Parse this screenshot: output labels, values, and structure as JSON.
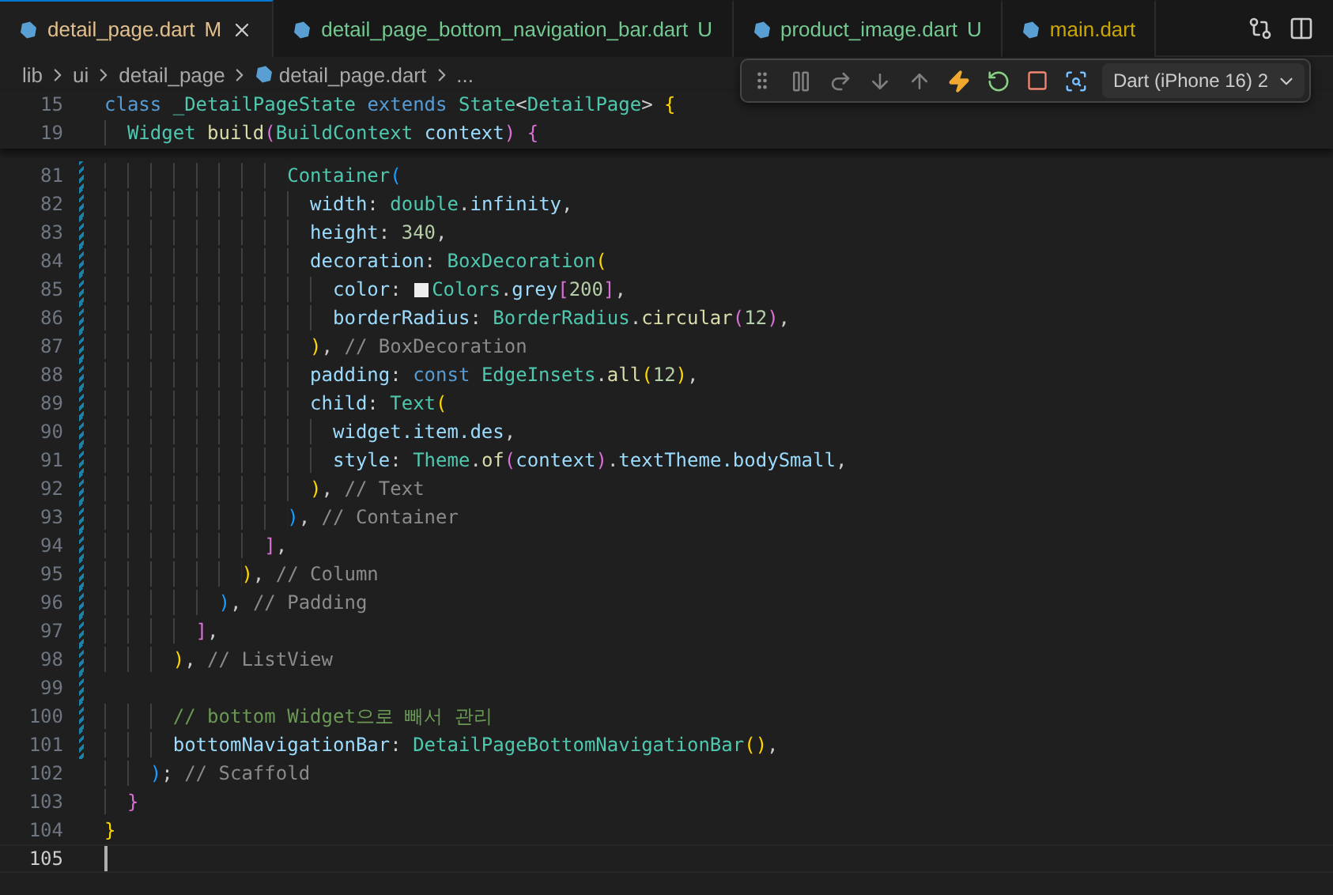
{
  "tabs": [
    {
      "label": "detail_page.dart",
      "badge": "M",
      "color": "#e2c08d",
      "selected": true
    },
    {
      "label": "detail_page_bottom_navigation_bar.dart",
      "badge": "U",
      "color": "#73c991",
      "selected": false
    },
    {
      "label": "product_image.dart",
      "badge": "U",
      "color": "#73c991",
      "selected": false
    },
    {
      "label": "main.dart",
      "color": "#cca700",
      "selected": false
    }
  ],
  "breadcrumb": [
    {
      "label": "lib",
      "kind": "folder"
    },
    {
      "label": "ui",
      "kind": "folder"
    },
    {
      "label": "detail_page",
      "kind": "folder"
    },
    {
      "label": "detail_page.dart",
      "kind": "file"
    },
    {
      "label": "...",
      "kind": "more"
    }
  ],
  "debug_toolbar": {
    "buttons": [
      {
        "kind": "grip",
        "disabled": false
      },
      {
        "kind": "pause",
        "disabled": true
      },
      {
        "kind": "step-over",
        "disabled": true
      },
      {
        "kind": "step-into",
        "disabled": true
      },
      {
        "kind": "step-out",
        "disabled": true
      },
      {
        "kind": "hot-reload",
        "disabled": false
      },
      {
        "kind": "restart",
        "disabled": false
      },
      {
        "kind": "stop",
        "disabled": false
      },
      {
        "kind": "inspect",
        "disabled": false
      }
    ],
    "device": "Dart (iPhone 16) 2"
  },
  "sticky_scroll": [
    {
      "number": "15",
      "tokens": [
        {
          "text": "class ",
          "kind": "kw"
        },
        {
          "text": "_DetailPageState ",
          "kind": "type"
        },
        {
          "text": "extends ",
          "kind": "kw"
        },
        {
          "text": "State",
          "kind": "type"
        },
        {
          "text": "<",
          "kind": "p"
        },
        {
          "text": "DetailPage",
          "kind": "type"
        },
        {
          "text": "> ",
          "kind": "p"
        },
        {
          "text": "{",
          "kind": "b1"
        }
      ]
    },
    {
      "number": "19",
      "tokens": [
        {
          "text": "  Widget ",
          "kind": "type"
        },
        {
          "text": "build",
          "kind": "fn"
        },
        {
          "text": "(",
          "kind": "b2"
        },
        {
          "text": "BuildContext ",
          "kind": "type"
        },
        {
          "text": "context",
          "kind": "prop"
        },
        {
          "text": ")",
          "kind": "b2"
        },
        {
          "text": " {",
          "kind": "b2"
        }
      ]
    }
  ],
  "lines": [
    {
      "number": "81",
      "modified": true,
      "current": false,
      "tokens": [
        {
          "text": "                Container",
          "kind": "type"
        },
        {
          "text": "(",
          "kind": "b3"
        }
      ]
    },
    {
      "number": "82",
      "modified": true,
      "current": false,
      "tokens": [
        {
          "text": "                  width",
          "kind": "prop"
        },
        {
          "text": ": ",
          "kind": "p"
        },
        {
          "text": "double",
          "kind": "type"
        },
        {
          "text": ".",
          "kind": "p"
        },
        {
          "text": "infinity",
          "kind": "prop"
        },
        {
          "text": ",",
          "kind": "p"
        }
      ]
    },
    {
      "number": "83",
      "modified": true,
      "current": false,
      "tokens": [
        {
          "text": "                  height",
          "kind": "prop"
        },
        {
          "text": ": ",
          "kind": "p"
        },
        {
          "text": "340",
          "kind": "num"
        },
        {
          "text": ",",
          "kind": "p"
        }
      ]
    },
    {
      "number": "84",
      "modified": true,
      "current": false,
      "tokens": [
        {
          "text": "                  decoration",
          "kind": "prop"
        },
        {
          "text": ": ",
          "kind": "p"
        },
        {
          "text": "BoxDecoration",
          "kind": "type"
        },
        {
          "text": "(",
          "kind": "b1"
        }
      ]
    },
    {
      "number": "85",
      "modified": true,
      "current": false,
      "tokens": [
        {
          "text": "                    color",
          "kind": "prop"
        },
        {
          "text": ": ",
          "kind": "p"
        },
        {
          "text": "Colors",
          "kind": "type",
          "color": "#eeeeee"
        },
        {
          "text": ".",
          "kind": "p"
        },
        {
          "text": "grey",
          "kind": "prop"
        },
        {
          "text": "[",
          "kind": "b2"
        },
        {
          "text": "200",
          "kind": "num"
        },
        {
          "text": "]",
          "kind": "b2"
        },
        {
          "text": ",",
          "kind": "p"
        }
      ]
    },
    {
      "number": "86",
      "modified": true,
      "current": false,
      "tokens": [
        {
          "text": "                    borderRadius",
          "kind": "prop"
        },
        {
          "text": ": ",
          "kind": "p"
        },
        {
          "text": "BorderRadius",
          "kind": "type"
        },
        {
          "text": ".",
          "kind": "p"
        },
        {
          "text": "circular",
          "kind": "fn"
        },
        {
          "text": "(",
          "kind": "b2"
        },
        {
          "text": "12",
          "kind": "num"
        },
        {
          "text": ")",
          "kind": "b2"
        },
        {
          "text": ",",
          "kind": "p"
        }
      ]
    },
    {
      "number": "87",
      "modified": true,
      "current": false,
      "tokens": [
        {
          "text": "                  )",
          "kind": "b1"
        },
        {
          "text": ", ",
          "kind": "p"
        },
        {
          "text": "// BoxDecoration",
          "kind": "label"
        }
      ]
    },
    {
      "number": "88",
      "modified": true,
      "current": false,
      "tokens": [
        {
          "text": "                  padding",
          "kind": "prop"
        },
        {
          "text": ": ",
          "kind": "p"
        },
        {
          "text": "const ",
          "kind": "kw"
        },
        {
          "text": "EdgeInsets",
          "kind": "type"
        },
        {
          "text": ".",
          "kind": "p"
        },
        {
          "text": "all",
          "kind": "fn"
        },
        {
          "text": "(",
          "kind": "b1"
        },
        {
          "text": "12",
          "kind": "num"
        },
        {
          "text": ")",
          "kind": "b1"
        },
        {
          "text": ",",
          "kind": "p"
        }
      ]
    },
    {
      "number": "89",
      "modified": true,
      "current": false,
      "tokens": [
        {
          "text": "                  child",
          "kind": "prop"
        },
        {
          "text": ": ",
          "kind": "p"
        },
        {
          "text": "Text",
          "kind": "type"
        },
        {
          "text": "(",
          "kind": "b1"
        }
      ]
    },
    {
      "number": "90",
      "modified": true,
      "current": false,
      "tokens": [
        {
          "text": "                    widget.item.des",
          "kind": "prop"
        },
        {
          "text": ",",
          "kind": "p"
        }
      ]
    },
    {
      "number": "91",
      "modified": true,
      "current": false,
      "tokens": [
        {
          "text": "                    style",
          "kind": "prop"
        },
        {
          "text": ": ",
          "kind": "p"
        },
        {
          "text": "Theme",
          "kind": "type"
        },
        {
          "text": ".",
          "kind": "p"
        },
        {
          "text": "of",
          "kind": "fn"
        },
        {
          "text": "(",
          "kind": "b2"
        },
        {
          "text": "context",
          "kind": "prop"
        },
        {
          "text": ")",
          "kind": "b2"
        },
        {
          "text": ".",
          "kind": "p"
        },
        {
          "text": "textTheme.bodySmall",
          "kind": "prop"
        },
        {
          "text": ",",
          "kind": "p"
        }
      ]
    },
    {
      "number": "92",
      "modified": true,
      "current": false,
      "tokens": [
        {
          "text": "                  )",
          "kind": "b1"
        },
        {
          "text": ", ",
          "kind": "p"
        },
        {
          "text": "// Text",
          "kind": "label"
        }
      ]
    },
    {
      "number": "93",
      "modified": true,
      "current": false,
      "tokens": [
        {
          "text": "                )",
          "kind": "b3"
        },
        {
          "text": ", ",
          "kind": "p"
        },
        {
          "text": "// Container",
          "kind": "label"
        }
      ]
    },
    {
      "number": "94",
      "modified": true,
      "current": false,
      "tokens": [
        {
          "text": "              ]",
          "kind": "b2"
        },
        {
          "text": ",",
          "kind": "p"
        }
      ]
    },
    {
      "number": "95",
      "modified": true,
      "current": false,
      "tokens": [
        {
          "text": "            )",
          "kind": "b1"
        },
        {
          "text": ", ",
          "kind": "p"
        },
        {
          "text": "// Column",
          "kind": "label"
        }
      ]
    },
    {
      "number": "96",
      "modified": true,
      "current": false,
      "tokens": [
        {
          "text": "          )",
          "kind": "b3"
        },
        {
          "text": ", ",
          "kind": "p"
        },
        {
          "text": "// Padding",
          "kind": "label"
        }
      ]
    },
    {
      "number": "97",
      "modified": true,
      "current": false,
      "tokens": [
        {
          "text": "        ]",
          "kind": "b2"
        },
        {
          "text": ",",
          "kind": "p"
        }
      ]
    },
    {
      "number": "98",
      "modified": true,
      "current": false,
      "tokens": [
        {
          "text": "      )",
          "kind": "b1"
        },
        {
          "text": ", ",
          "kind": "p"
        },
        {
          "text": "// ListView",
          "kind": "label"
        }
      ]
    },
    {
      "number": "99",
      "modified": true,
      "current": false
    },
    {
      "number": "100",
      "modified": true,
      "current": false,
      "tokens": [
        {
          "text": "      // bottom Widget으로 빼서 관리",
          "kind": "cmt"
        }
      ]
    },
    {
      "number": "101",
      "modified": true,
      "current": false,
      "tokens": [
        {
          "text": "      bottomNavigationBar",
          "kind": "prop"
        },
        {
          "text": ": ",
          "kind": "p"
        },
        {
          "text": "DetailPageBottomNavigationBar",
          "kind": "type"
        },
        {
          "text": "()",
          "kind": "b1"
        },
        {
          "text": ",",
          "kind": "p"
        }
      ]
    },
    {
      "number": "102",
      "modified": false,
      "current": false,
      "tokens": [
        {
          "text": "    )",
          "kind": "b3"
        },
        {
          "text": "; ",
          "kind": "p"
        },
        {
          "text": "// Scaffold",
          "kind": "label"
        }
      ]
    },
    {
      "number": "103",
      "modified": false,
      "current": false,
      "tokens": [
        {
          "text": "  }",
          "kind": "b2"
        }
      ]
    },
    {
      "number": "104",
      "modified": false,
      "current": false,
      "tokens": [
        {
          "text": "}",
          "kind": "b1"
        }
      ]
    },
    {
      "number": "105",
      "modified": false,
      "current": true
    }
  ]
}
